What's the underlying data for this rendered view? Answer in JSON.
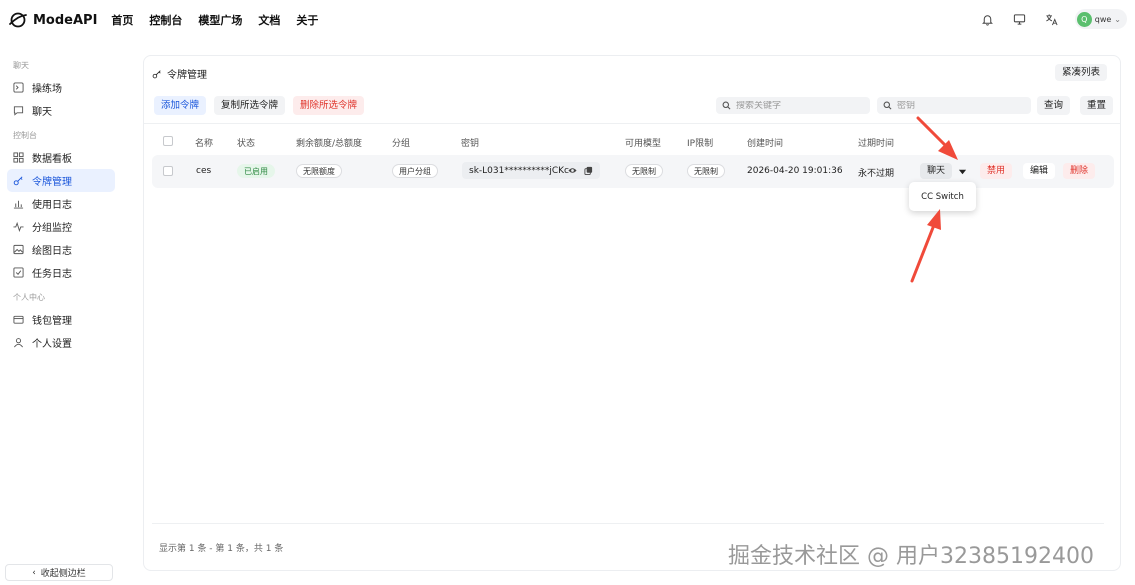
{
  "app": {
    "name": "ModeAPI"
  },
  "topnav": {
    "items": [
      "首页",
      "控制台",
      "模型广场",
      "文档",
      "关于"
    ]
  },
  "user": {
    "avatar_letter": "Q",
    "name": "qwe"
  },
  "sidebar": {
    "sections": [
      {
        "title": "聊天",
        "items": [
          {
            "label": "操练场",
            "icon": "playground-icon"
          },
          {
            "label": "聊天",
            "icon": "chat-icon"
          }
        ]
      },
      {
        "title": "控制台",
        "items": [
          {
            "label": "数据看板",
            "icon": "dashboard-icon"
          },
          {
            "label": "令牌管理",
            "icon": "key-icon",
            "active": true
          },
          {
            "label": "使用日志",
            "icon": "bar-chart-icon"
          },
          {
            "label": "分组监控",
            "icon": "pulse-icon"
          },
          {
            "label": "绘图日志",
            "icon": "image-icon"
          },
          {
            "label": "任务日志",
            "icon": "task-icon"
          }
        ]
      },
      {
        "title": "个人中心",
        "items": [
          {
            "label": "钱包管理",
            "icon": "wallet-icon"
          },
          {
            "label": "个人设置",
            "icon": "user-icon"
          }
        ]
      }
    ],
    "collapse_label": "收起侧边栏"
  },
  "page": {
    "title": "令牌管理",
    "compact_label": "紧凑列表",
    "actions": {
      "add": "添加令牌",
      "copy": "复制所选令牌",
      "delete": "删除所选令牌"
    },
    "search": {
      "keyword_placeholder": "搜索关键字",
      "key_placeholder": "密钥",
      "query": "查询",
      "reset": "重置"
    }
  },
  "table": {
    "columns": [
      "名称",
      "状态",
      "剩余额度/总额度",
      "分组",
      "密钥",
      "可用模型",
      "IP限制",
      "创建时间",
      "过期时间"
    ],
    "rows": [
      {
        "name": "ces",
        "status": "已启用",
        "quota": "无限额度",
        "group": "用户分组",
        "key": "sk-L031**********jCKc",
        "models": "无限制",
        "ip": "无限制",
        "created": "2026-04-20 19:01:36",
        "expires": "永不过期",
        "actions": {
          "chat": "聊天",
          "disable": "禁用",
          "edit": "编辑",
          "delete": "删除"
        }
      }
    ],
    "dropdown_item": "CC Switch",
    "footer": "显示第 1 条 - 第 1 条，共 1 条"
  },
  "watermark": "掘金技术社区 @ 用户3238519240​0",
  "colors": {
    "accent": "#1a56db",
    "danger": "#e0342c",
    "success": "#2f8a43",
    "annotation": "#f04a3a"
  }
}
